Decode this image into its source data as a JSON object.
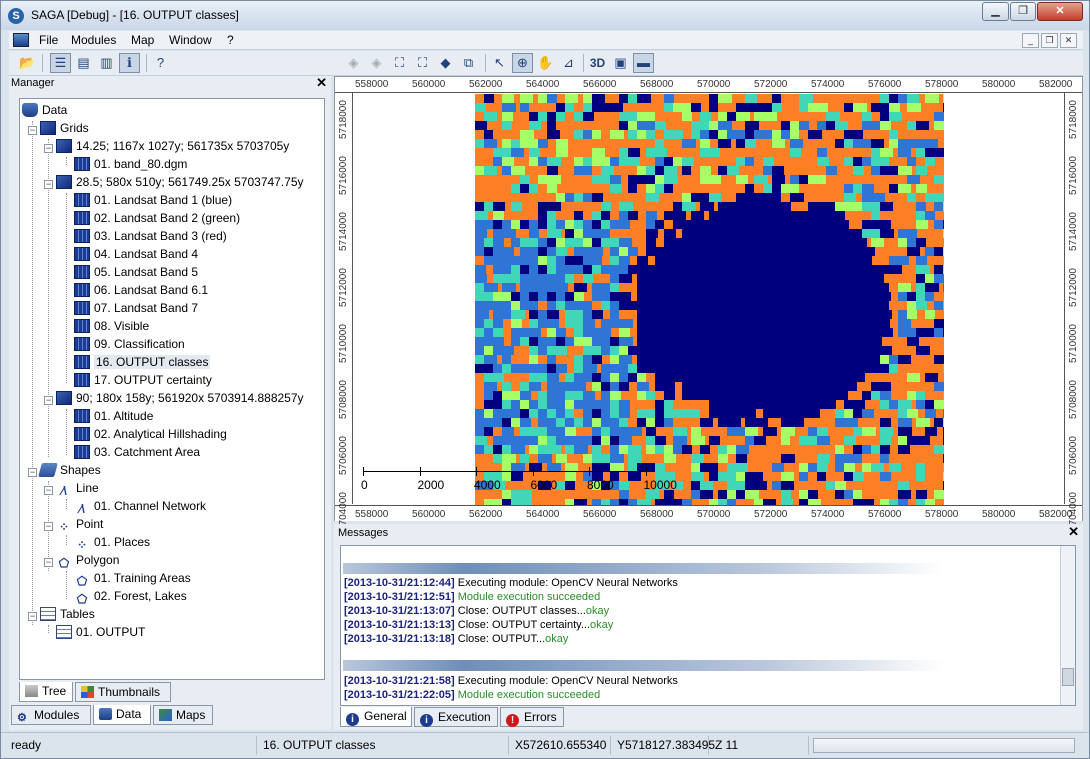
{
  "window": {
    "title": "SAGA [Debug] - [16. OUTPUT classes]",
    "app_icon": "saga-icon"
  },
  "menubar": {
    "items": [
      "File",
      "Modules",
      "Map",
      "Window",
      "?"
    ]
  },
  "manager": {
    "title": "Manager",
    "tree": {
      "data": "Data",
      "grids": "Grids",
      "system1": "14.25; 1167x 1027y; 561735x 5703705y",
      "system1_items": [
        "01. band_80.dgm"
      ],
      "system2": "28.5; 580x 510y; 561749.25x 5703747.75y",
      "system2_items": [
        "01. Landsat Band 1 (blue)",
        "02. Landsat Band 2 (green)",
        "03. Landsat Band 3 (red)",
        "04. Landsat Band 4",
        "05. Landsat Band 5",
        "06. Landsat Band 6.1",
        "07. Landsat Band 7",
        "08. Visible",
        "09. Classification",
        "16. OUTPUT classes",
        "17. OUTPUT certainty"
      ],
      "system3": "90; 180x 158y; 561920x 5703914.888257y",
      "system3_items": [
        "01. Altitude",
        "02. Analytical Hillshading",
        "03. Catchment Area"
      ],
      "shapes": "Shapes",
      "line": "Line",
      "line_items": [
        "01. Channel Network"
      ],
      "point": "Point",
      "point_items": [
        "01. Places"
      ],
      "polygon": "Polygon",
      "polygon_items": [
        "01. Training Areas",
        "02. Forest, Lakes"
      ],
      "tables": "Tables",
      "table_items": [
        "01. OUTPUT"
      ]
    },
    "inner_tabs": [
      "Tree",
      "Thumbnails"
    ],
    "outer_tabs": [
      "Modules",
      "Data",
      "Maps"
    ]
  },
  "map": {
    "x_ticks": [
      "558000",
      "560000",
      "562000",
      "564000",
      "566000",
      "568000",
      "570000",
      "572000",
      "574000",
      "576000",
      "578000",
      "580000",
      "582000"
    ],
    "y_ticks": [
      "5718000",
      "5716000",
      "5714000",
      "5712000",
      "5710000",
      "5708000",
      "5706000",
      "5704000"
    ],
    "scalebar": [
      "0",
      "2000",
      "4000",
      "6000",
      "8000",
      "10000"
    ],
    "class_colors": [
      "#00007f",
      "#ff7f27",
      "#2e75d6",
      "#40d6b8",
      "#a6ff66"
    ]
  },
  "messages": {
    "title": "Messages",
    "lines": [
      {
        "ts": "[2013-10-31/21:12:44]",
        "text": "Executing module: OpenCV Neural Networks",
        "ok": ""
      },
      {
        "ts": "[2013-10-31/21:12:51]",
        "text": "",
        "ok": "Module execution succeeded"
      },
      {
        "ts": "[2013-10-31/21:13:07]",
        "text": "Close: OUTPUT classes...",
        "ok": "okay"
      },
      {
        "ts": "[2013-10-31/21:13:13]",
        "text": "Close: OUTPUT certainty...",
        "ok": "okay"
      },
      {
        "ts": "[2013-10-31/21:13:18]",
        "text": "Close: OUTPUT...",
        "ok": "okay"
      },
      {
        "ts": "[2013-10-31/21:21:58]",
        "text": "Executing module: OpenCV Neural Networks",
        "ok": ""
      },
      {
        "ts": "[2013-10-31/21:22:05]",
        "text": "",
        "ok": "Module execution succeeded"
      }
    ],
    "tabs": [
      "General",
      "Execution",
      "Errors"
    ]
  },
  "status": {
    "state": "ready",
    "layer": "16. OUTPUT classes",
    "x": "X572610.655340",
    "y": "Y5718127.383495",
    "z": "Z 11"
  }
}
